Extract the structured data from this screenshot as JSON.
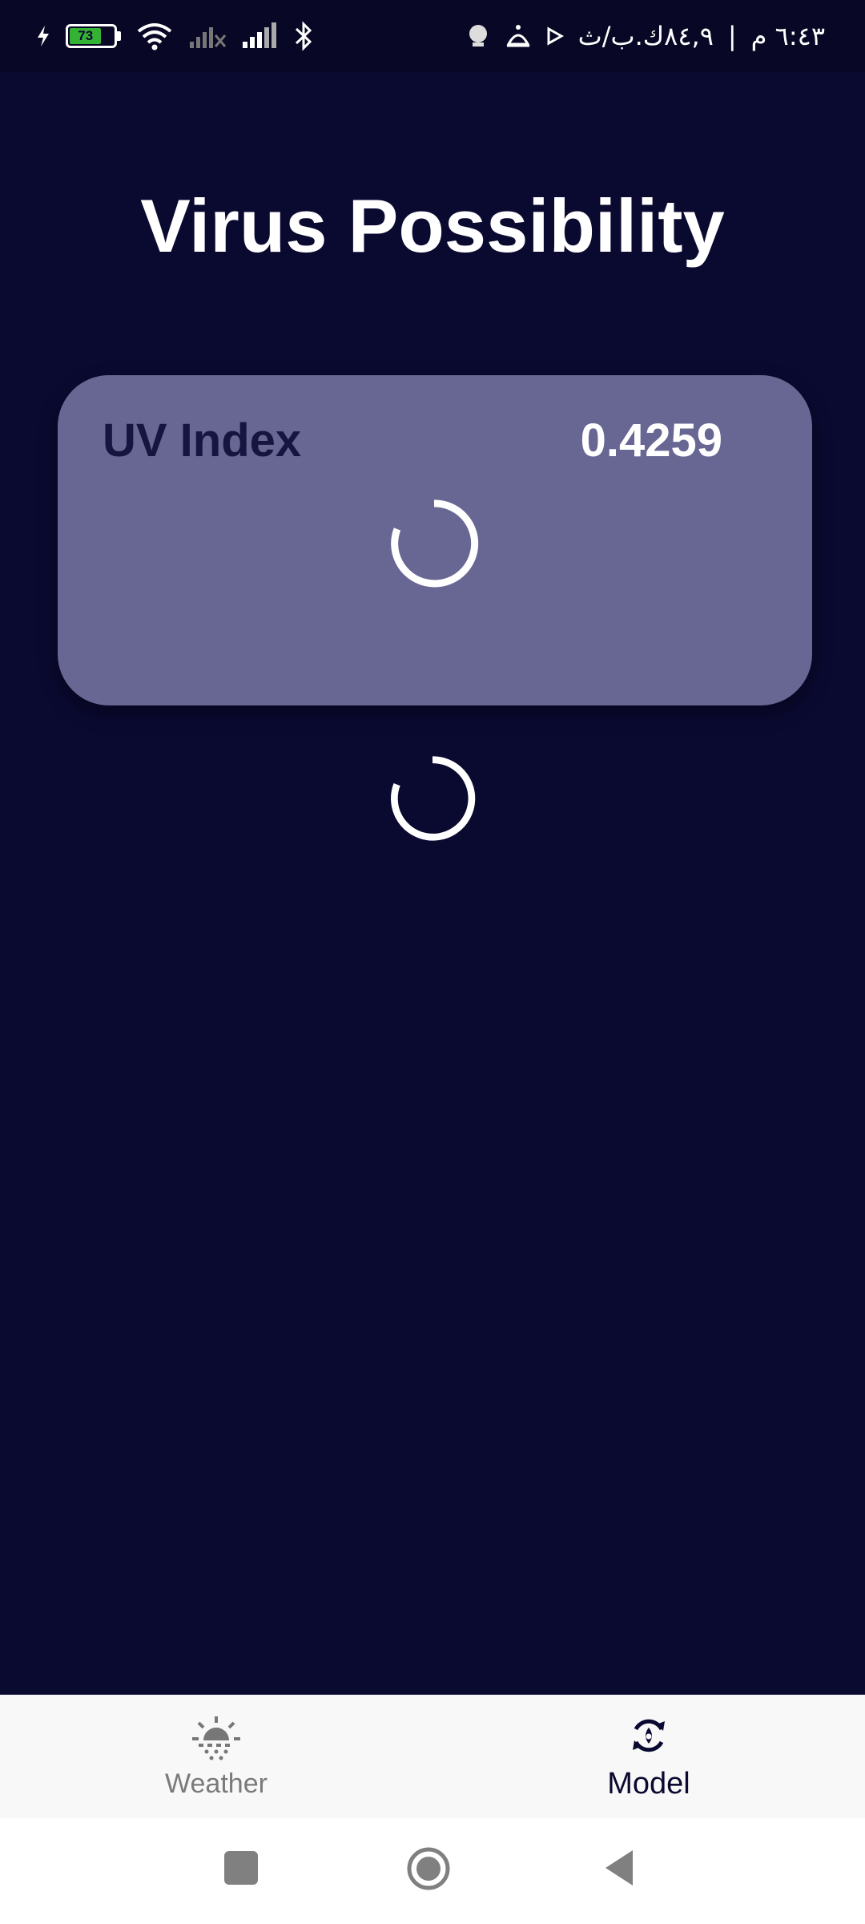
{
  "status_bar": {
    "battery_level": "73",
    "time": "٦:٤٣ م",
    "network_speed": "٨٤,٩ك.ب/ث",
    "icons": [
      "charging-icon",
      "battery-icon",
      "wifi-icon",
      "no-signal-icon",
      "signal-icon",
      "bluetooth-icon",
      "notification-icon",
      "alarm-icon",
      "play-icon"
    ]
  },
  "page": {
    "title": "Virus Possibility"
  },
  "uv_card": {
    "label": "UV Index",
    "value": "0.4259",
    "background_color": "#686794"
  },
  "bottom_nav": {
    "items": [
      {
        "label": "Weather",
        "icon": "weather-sun-icon",
        "active": false
      },
      {
        "label": "Model",
        "icon": "model-refresh-icon",
        "active": true
      }
    ]
  },
  "system_nav": {
    "buttons": [
      "recents-button",
      "home-button",
      "back-button"
    ]
  },
  "colors": {
    "background": "#0a0930",
    "card": "#686794",
    "card_label": "#161540",
    "nav_background": "#f8f8f8"
  }
}
